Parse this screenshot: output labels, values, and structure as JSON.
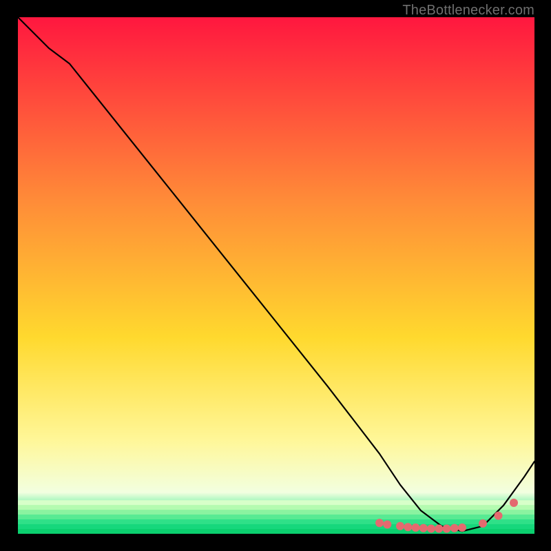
{
  "watermark": "TheBottlenecker.com",
  "gradient": {
    "top": "#ff173f",
    "mid_upper": "#ff6a3a",
    "mid": "#ffd92e",
    "mid_lower": "#fff799",
    "pale": "#f2ffe0",
    "green": "#12e67a",
    "bottom_band": "#0bd46e"
  },
  "chart_data": {
    "type": "line",
    "title": "",
    "xlabel": "",
    "ylabel": "",
    "xlim": [
      0,
      100
    ],
    "ylim": [
      0,
      100
    ],
    "series": [
      {
        "name": "curve",
        "x": [
          0,
          6,
          10,
          20,
          30,
          40,
          50,
          60,
          65,
          70,
          74,
          78,
          82,
          86,
          90,
          94,
          98,
          100
        ],
        "y": [
          100,
          94,
          91,
          78.5,
          66,
          53.5,
          41,
          28.5,
          22,
          15.5,
          9.5,
          4.5,
          1.5,
          0.5,
          1.5,
          5.5,
          11,
          14
        ]
      }
    ],
    "markers": {
      "name": "dots",
      "color": "#e46a6f",
      "x": [
        70,
        71.5,
        74,
        75.5,
        77,
        78.5,
        80,
        81.5,
        83,
        84.5,
        86,
        90,
        93,
        96
      ],
      "y": [
        2.1,
        1.8,
        1.5,
        1.3,
        1.2,
        1.1,
        1.0,
        1.0,
        1.0,
        1.1,
        1.2,
        2.0,
        3.5,
        6.0
      ]
    }
  }
}
